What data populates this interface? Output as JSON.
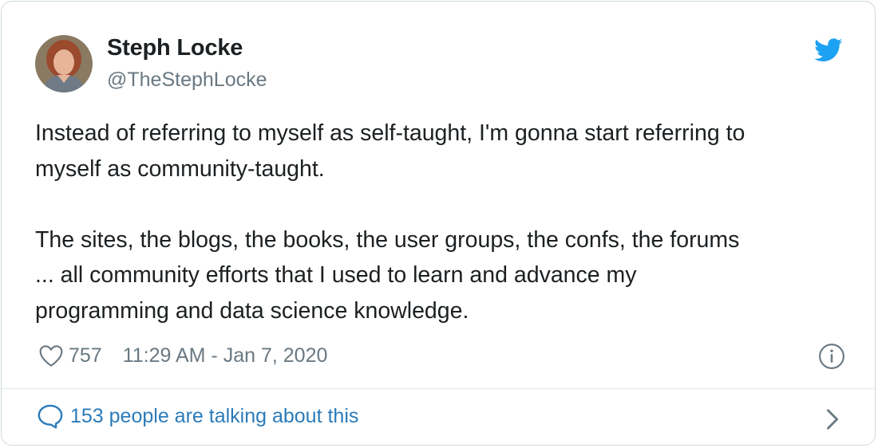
{
  "author": {
    "name": "Steph Locke",
    "handle": "@TheStephLocke"
  },
  "tweet": {
    "lines": [
      "Instead of referring to myself as self-taught, I'm gonna start referring to",
      "myself as community-taught.",
      "",
      "The sites, the blogs, the books, the user groups, the confs, the forums",
      "... all community efforts that I used to learn and advance my",
      "programming and data science knowledge."
    ]
  },
  "meta": {
    "like_count": "757",
    "timestamp": "11:29 AM - Jan 7, 2020"
  },
  "footer": {
    "talking_label": "153 people are talking about this"
  },
  "icons": {
    "brand": "twitter-bird-icon",
    "like": "heart-icon",
    "info": "info-icon",
    "comment": "speech-bubble-icon",
    "chevron": "chevron-right-icon"
  },
  "colors": {
    "brand_blue": "#1da1f2",
    "link_blue": "#2b7bb9",
    "muted": "#697882",
    "text": "#1c2022",
    "border": "#cfd9de"
  }
}
